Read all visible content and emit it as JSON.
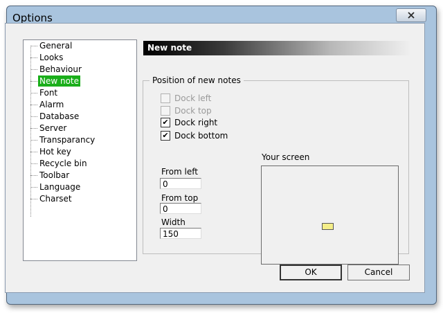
{
  "window": {
    "title": "Options"
  },
  "tree": {
    "items": [
      {
        "label": "General"
      },
      {
        "label": "Looks"
      },
      {
        "label": "Behaviour"
      },
      {
        "label": "New note",
        "selected": true
      },
      {
        "label": "Font"
      },
      {
        "label": "Alarm"
      },
      {
        "label": "Database"
      },
      {
        "label": "Server"
      },
      {
        "label": "Transparancy"
      },
      {
        "label": "Hot key"
      },
      {
        "label": "Recycle bin"
      },
      {
        "label": "Toolbar"
      },
      {
        "label": "Language"
      },
      {
        "label": "Charset"
      }
    ]
  },
  "panel": {
    "header": "New note",
    "group_title": "Position of new notes",
    "checkboxes": {
      "dock_left": {
        "label": "Dock left",
        "checked": false,
        "enabled": false
      },
      "dock_top": {
        "label": "Dock top",
        "checked": false,
        "enabled": false
      },
      "dock_right": {
        "label": "Dock right",
        "checked": true,
        "enabled": true
      },
      "dock_bottom": {
        "label": "Dock bottom",
        "checked": true,
        "enabled": true
      }
    },
    "fields": {
      "from_left": {
        "label": "From left",
        "value": "0"
      },
      "from_top": {
        "label": "From top",
        "value": "0"
      },
      "width": {
        "label": "Width",
        "value": "150"
      }
    },
    "screen_label": "Your screen"
  },
  "buttons": {
    "ok": "OK",
    "cancel": "Cancel"
  },
  "colors": {
    "selection": "#1aae1a",
    "note": "#f4ee88",
    "frame": "#a9c4de"
  },
  "icons": {
    "close": "close-icon",
    "check": "check-icon"
  }
}
